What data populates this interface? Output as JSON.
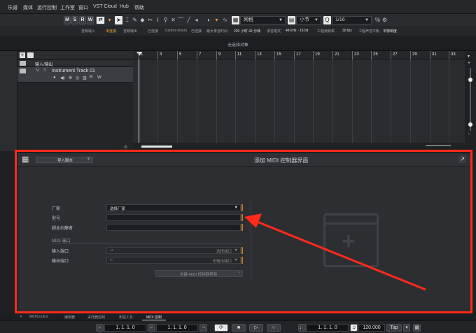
{
  "menu": [
    "乐谱",
    "媒体",
    "运行控制",
    "工作室",
    "窗口",
    "VST Cloud",
    "Hub",
    "帮助"
  ],
  "toolbar": {
    "m": "M",
    "s": "S",
    "r": "R",
    "w": "W",
    "grid_type": "网格",
    "quantize_label": "小节",
    "quantize_value": "1/16",
    "snap_icon": "%"
  },
  "status": {
    "items": [
      {
        "label": "音频输入",
        "value": "未连接"
      },
      {
        "label": "音频输出",
        "value": "已连接"
      },
      {
        "label": "Control Room",
        "value": "已连接"
      },
      {
        "label": "最大录音时间",
        "value": "220 小时 42 分钟"
      },
      {
        "label": "录音格式",
        "value": "48 kHz - 16 bit"
      },
      {
        "label": "工程帧频率",
        "value": "30 fps"
      },
      {
        "label": "工程声音平衡",
        "value": "平衡响度"
      }
    ]
  },
  "info": {
    "no_object": "无选择对象"
  },
  "tracks": {
    "header": "输入/输出",
    "track_name": "Instrument Track 01",
    "m": "M",
    "s": "S",
    "r": "R",
    "w": "W"
  },
  "ruler": {
    "bars": [
      "1",
      "3",
      "5",
      "7",
      "9",
      "11",
      "13",
      "15",
      "17",
      "19",
      "21",
      "23",
      "25",
      "27",
      "29",
      "31",
      "33"
    ]
  },
  "midi_panel": {
    "title": "添加 MIDI 控制器界面",
    "import_label": "导入脚本",
    "manufacturer_label": "厂家",
    "manufacturer_value": "选择厂家",
    "model_label": "型号",
    "script_author_label": "脚本创建者",
    "midi_ports_label": "MIDI 端口",
    "input_port_label": "输入端口",
    "input_port_value": "选择端口",
    "output_port_label": "输出端口",
    "output_port_value": "无输出端口",
    "create_button": "创建 MIDI 控制器界面",
    "plus": "+"
  },
  "bottom_tabs": [
    "MIDIControl",
    "编辑器",
    "采样器控制",
    "和弦工具",
    "MIDI 控制"
  ],
  "transport": {
    "left_locator": "1. 1. 1.  0",
    "right_locator": "1. 1. 1.  0",
    "position": "1. 1. 1.  0",
    "tempo": "120.000",
    "tap": "Tap"
  },
  "colors": {
    "accent": "#c07a2a",
    "highlight": "#ff2a1a",
    "warning_text": "#e8a33a"
  }
}
